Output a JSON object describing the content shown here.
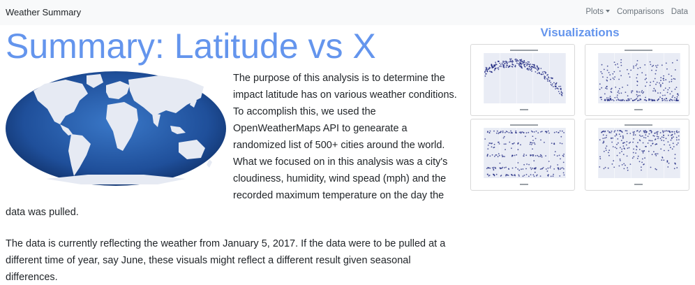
{
  "navbar": {
    "brand": "Weather Summary",
    "links": [
      {
        "label": "Plots",
        "dropdown": true
      },
      {
        "label": "Comparisons",
        "dropdown": false
      },
      {
        "label": "Data",
        "dropdown": false
      }
    ]
  },
  "main": {
    "title": "Summary: Latitude vs X",
    "image_icon": "world-map",
    "paragraphs": [
      "The purpose of this analysis is to determine the impact latitude has on various weather conditions. To accomplish this, we used the OpenWeatherMaps API to genearate a randomized list of 500+ cities around the world. What we focused on in this analysis was a city's cloudiness, humidity, wind spead (mph) and the recorded maximum temperature on the day the data was pulled.",
      "The data is currently reflecting the weather from January 5, 2017. If the data were to be pulled at a different time of year, say June, these visuals might reflect a different result given seasonal differences."
    ]
  },
  "sidebar": {
    "title": "Visualizations",
    "thumbnails": [
      {
        "id": "max-temp",
        "kind": "arc"
      },
      {
        "id": "wind-speed",
        "kind": "low"
      },
      {
        "id": "cloudiness",
        "kind": "bands"
      },
      {
        "id": "humidity",
        "kind": "high"
      }
    ]
  },
  "colors": {
    "accent": "#6495ED",
    "navbar_bg": "#f8f9fa",
    "map_ocean": "#1f4f9a",
    "map_land": "#e6eaf3",
    "plot_bg": "#e9ecf5",
    "plot_point": "#1a237e"
  }
}
